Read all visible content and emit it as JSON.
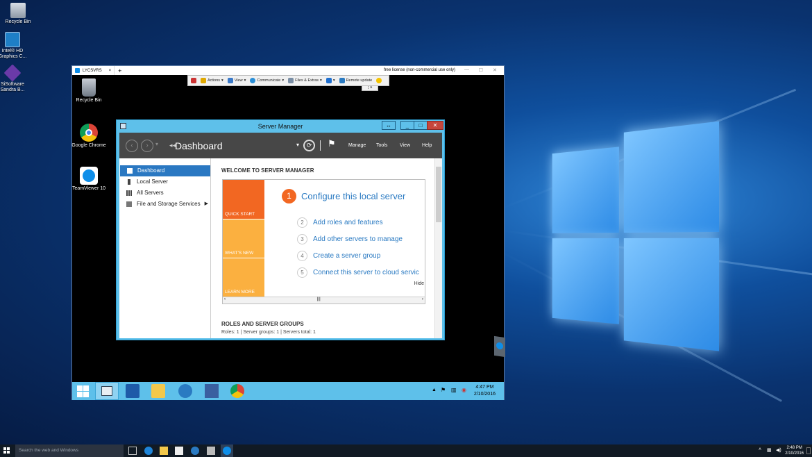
{
  "host_desktop": {
    "icons": [
      {
        "label": "Recycle Bin",
        "icon": "recycle-bin-icon"
      },
      {
        "label": "Intel® HD Graphics C...",
        "icon": "intel-graphics-icon"
      },
      {
        "label": "SiSoftware Sandra B...",
        "icon": "sisoftware-sandra-icon"
      }
    ]
  },
  "teamviewer": {
    "tab_label": "LYCSVRS",
    "new_tab": "+",
    "close_tab": "×",
    "license_text": "free license (non-commercial use only)",
    "toolbar": {
      "actions": "Actions",
      "view": "View",
      "communicate": "Communicate",
      "files": "Files & Extras",
      "remote_update": "Remote update"
    }
  },
  "remote_desktop": {
    "icons": [
      {
        "label": "Recycle Bin"
      },
      {
        "label": "Google Chrome"
      },
      {
        "label": "TeamViewer 10"
      }
    ]
  },
  "server_manager": {
    "title": "Server Manager",
    "breadcrumb": "Dashboard",
    "header_menu": [
      "Manage",
      "Tools",
      "View",
      "Help"
    ],
    "nav": [
      {
        "label": "Dashboard"
      },
      {
        "label": "Local Server"
      },
      {
        "label": "All Servers"
      },
      {
        "label": "File and Storage Services"
      }
    ],
    "welcome": "WELCOME TO SERVER MANAGER",
    "tiles": {
      "quick_start": "QUICK START",
      "whats_new": "WHAT'S NEW",
      "learn_more": "LEARN MORE"
    },
    "steps": [
      {
        "num": "1",
        "label": "Configure this local server"
      },
      {
        "num": "2",
        "label": "Add roles and features"
      },
      {
        "num": "3",
        "label": "Add other servers to manage"
      },
      {
        "num": "4",
        "label": "Create a server group"
      },
      {
        "num": "5",
        "label": "Connect this server to cloud servic"
      }
    ],
    "hide": "Hide",
    "roles_heading": "ROLES AND SERVER GROUPS",
    "roles_summary": "Roles: 1   |   Server groups: 1   |   Servers total: 1"
  },
  "remote_taskbar": {
    "time": "4:47 PM",
    "date": "2/10/2016"
  },
  "host_taskbar": {
    "search_placeholder": "Search the web and Windows",
    "time": "2:48 PM",
    "date": "2/10/2016"
  },
  "colors": {
    "accent": "#5ec0ea",
    "quick_start": "#f26722",
    "tile_orange": "#fbb040",
    "link": "#2a7ac2"
  }
}
